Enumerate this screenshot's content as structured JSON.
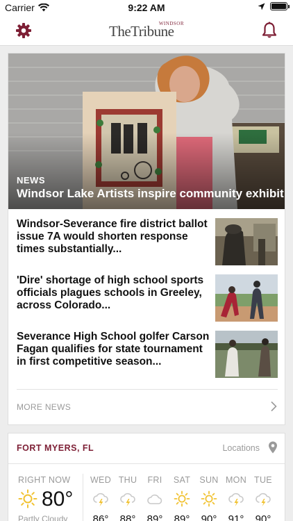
{
  "status": {
    "carrier": "Carrier",
    "time": "9:22 AM"
  },
  "header": {
    "logo_small": "WINDSOR",
    "logo_main": "TheTribune"
  },
  "feature": {
    "category": "NEWS",
    "title": "Windsor Lake Artists inspire community exhibit"
  },
  "stories": [
    {
      "title": "Windsor-Severance fire district ballot issue 7A would shorten response times substantially..."
    },
    {
      "title": "'Dire' shortage of high school sports officials plagues schools in Greeley, across Colorado..."
    },
    {
      "title": "Severance High School golfer Carson Fagan qualifies for state tournament in first competitive season..."
    }
  ],
  "more_news_label": "MORE NEWS",
  "weather": {
    "location": "FORT MYERS, FL",
    "locations_link": "Locations",
    "right_now_label": "RIGHT NOW",
    "current_temp": "80°",
    "current_condition": "Partly Cloudy",
    "current_icon": "sun-icon",
    "forecast": [
      {
        "day": "WED",
        "icon": "thunderstorm-icon",
        "temp": "86°"
      },
      {
        "day": "THU",
        "icon": "thunderstorm-icon",
        "temp": "88°"
      },
      {
        "day": "FRI",
        "icon": "cloud-icon",
        "temp": "89°"
      },
      {
        "day": "SAT",
        "icon": "sun-icon",
        "temp": "89°"
      },
      {
        "day": "SUN",
        "icon": "sun-icon",
        "temp": "90°"
      },
      {
        "day": "MON",
        "icon": "thunderstorm-icon",
        "temp": "91°"
      },
      {
        "day": "TUE",
        "icon": "thunderstorm-icon",
        "temp": "90°"
      }
    ]
  },
  "colors": {
    "accent": "#7d1f35",
    "muted_text": "#9a9a9a",
    "sun": "#f1c232"
  }
}
